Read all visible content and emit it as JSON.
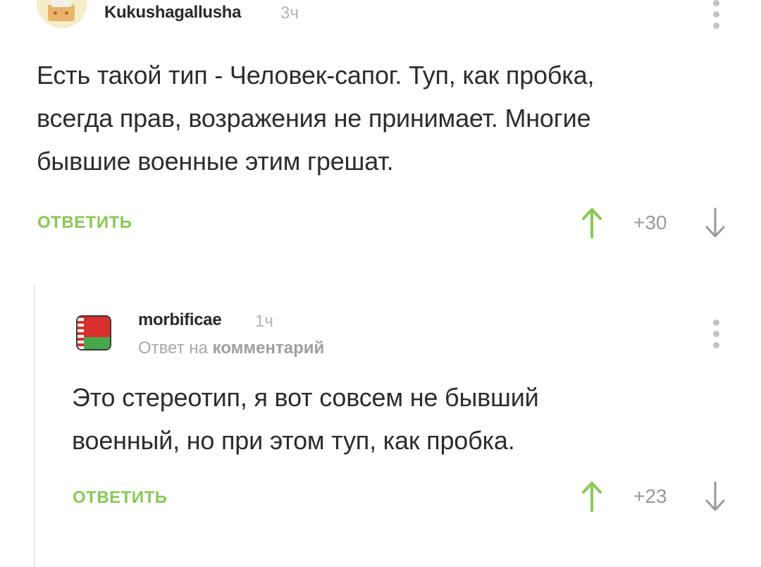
{
  "comment1": {
    "username": "Kukushagallusha",
    "time": "3ч",
    "lines": [
      "Есть такой тип - Человек-сапог. Туп, как пробка,",
      "всегда прав, возражения не принимает. Многие",
      "бывшие военные этим грешат."
    ],
    "reply_label": "ОТВЕТИТЬ",
    "rating": "+30"
  },
  "comment2": {
    "username": "morbificae",
    "time": "1ч",
    "reply_to_prefix": "Ответ на",
    "reply_to_target": "комментарий",
    "lines": [
      "Это стереотип, я вот совсем не бывший",
      "военный, но при этом туп, как пробка."
    ],
    "reply_label": "ОТВЕТИТЬ",
    "rating": "+23"
  },
  "colors": {
    "accent_green": "#8ac858",
    "muted_gray": "#b5b5b5",
    "text": "#2d2d2d"
  },
  "icons": {
    "avatar1": "cake-avatar",
    "avatar2": "belarus-flag-avatar",
    "menu": "more-vertical-icon",
    "upvote": "arrow-up-icon",
    "downvote": "arrow-down-icon"
  }
}
